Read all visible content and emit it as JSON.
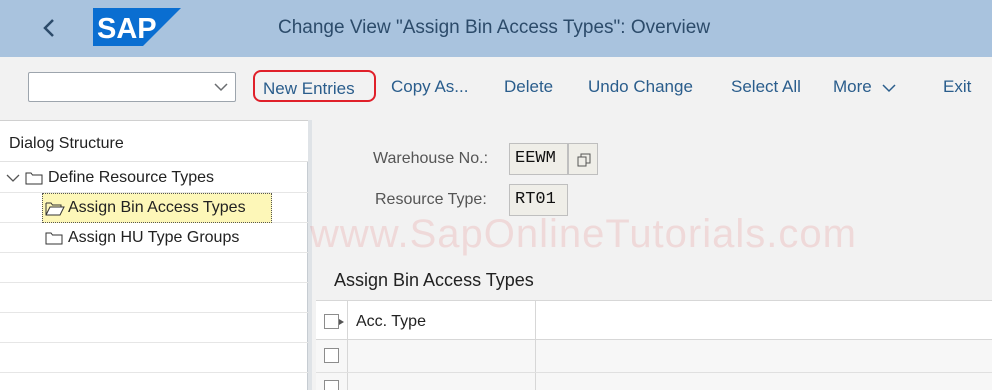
{
  "header": {
    "title": "Change View \"Assign Bin Access Types\": Overview",
    "logo_text": "SAP",
    "logo_color": "#0a6ed1",
    "back_icon": "chevron-left-icon"
  },
  "toolbar": {
    "combo_value": "",
    "new_entries": "New Entries",
    "copy_as": "Copy As...",
    "delete": "Delete",
    "undo_change": "Undo Change",
    "select_all": "Select All",
    "more": "More",
    "exit": "Exit",
    "highlight_color": "#e0202a"
  },
  "dialog_structure": {
    "title": "Dialog Structure",
    "items": [
      {
        "label": "Define Resource Types",
        "expanded": true,
        "level": 0
      },
      {
        "label": "Assign Bin Access Types",
        "selected": true,
        "level": 1
      },
      {
        "label": "Assign HU Type Groups",
        "level": 1
      }
    ]
  },
  "fields": {
    "warehouse_label": "Warehouse No.:",
    "warehouse_value": "EEWM",
    "resource_type_label": "Resource Type:",
    "resource_type_value": "RT01"
  },
  "watermark": "www.SapOnlineTutorials.com",
  "section": {
    "title": "Assign Bin Access Types",
    "columns": [
      "Acc. Type"
    ],
    "rows": [
      {
        "acc_type": ""
      },
      {
        "acc_type": ""
      }
    ]
  }
}
